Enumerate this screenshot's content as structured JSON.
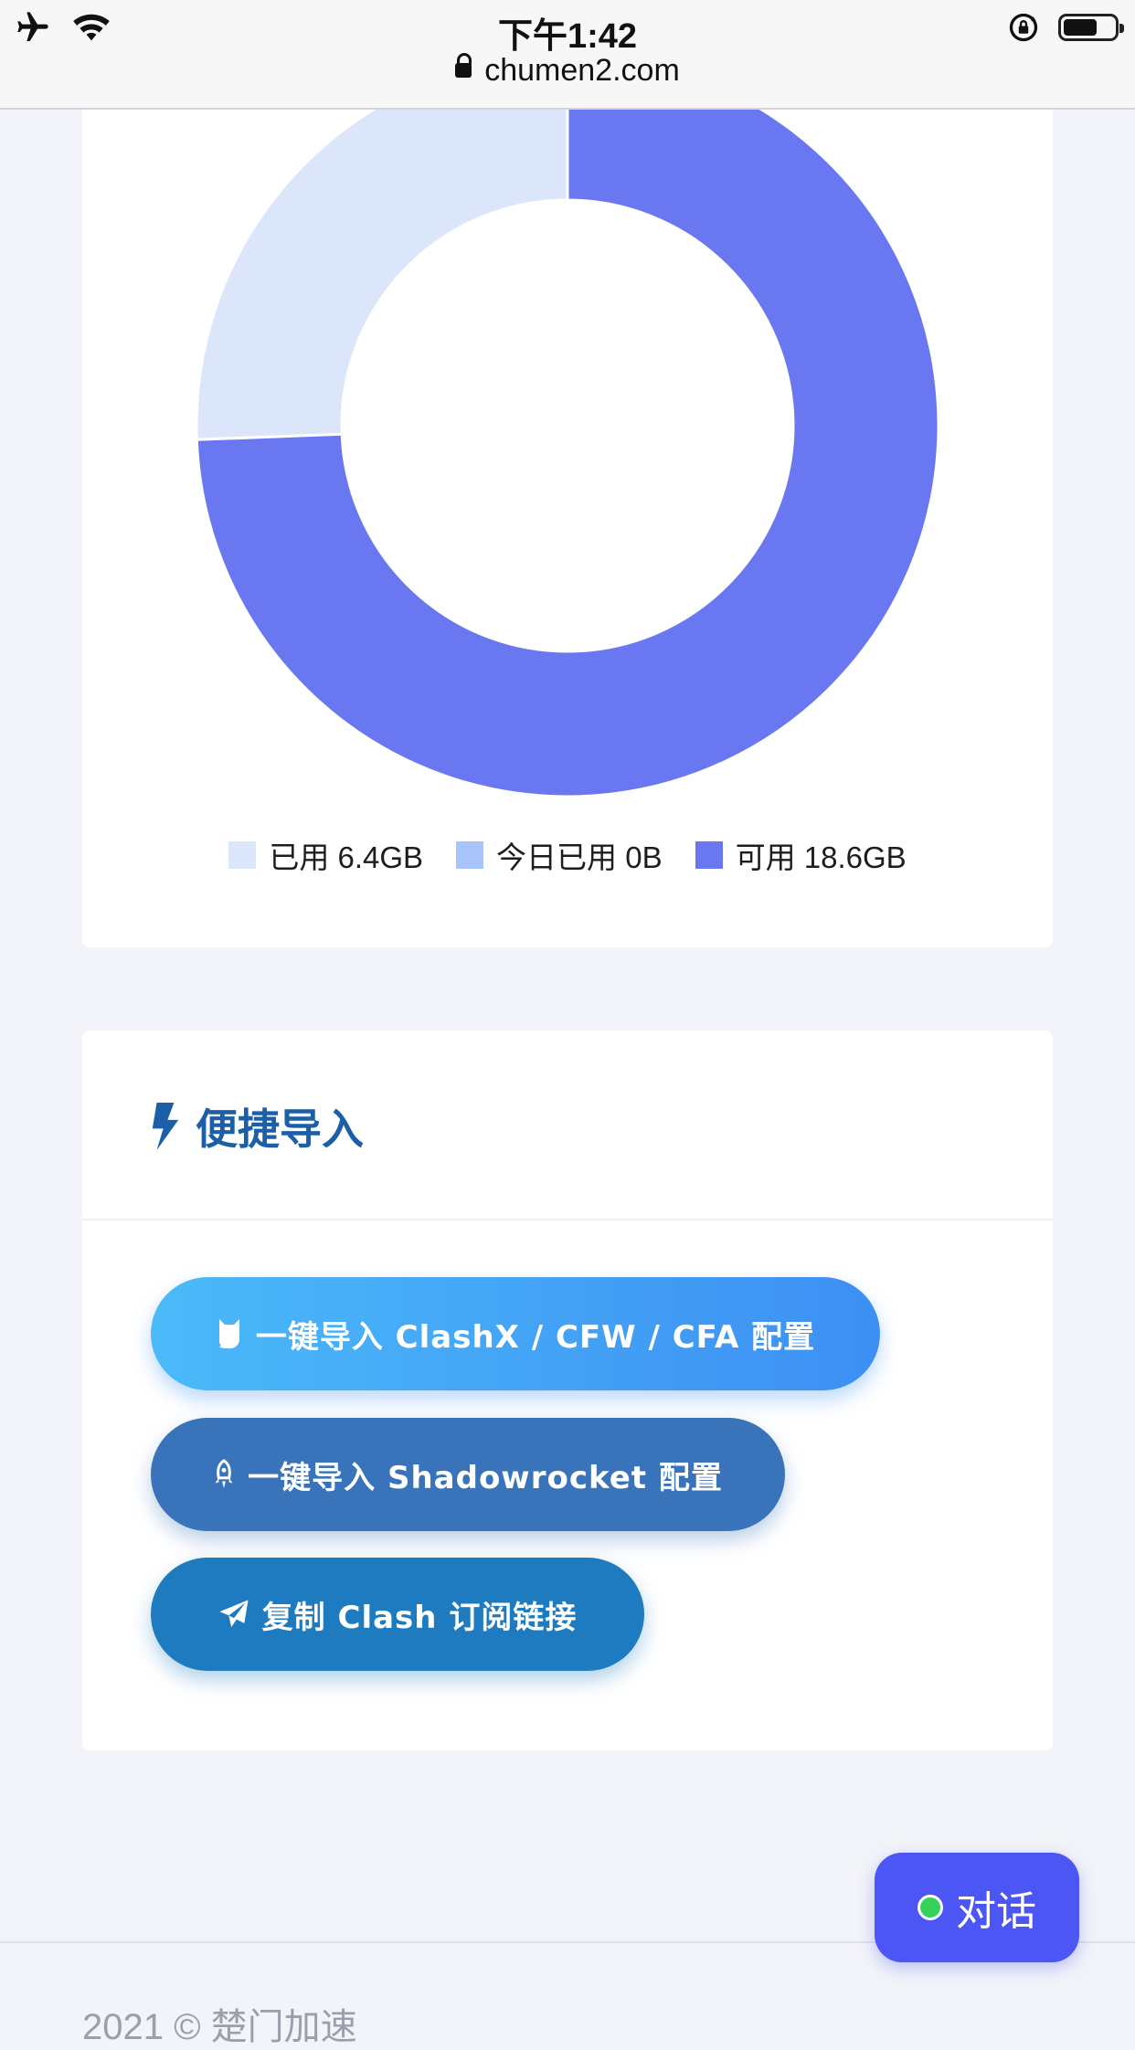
{
  "status_bar": {
    "time": "下午1:42"
  },
  "url_bar": {
    "domain": "chumen2.com"
  },
  "usage_chart": {
    "legend": [
      {
        "label": "已用 6.4GB",
        "color": "#dce6fb"
      },
      {
        "label": "今日已用 0B",
        "color": "#a9c4fb"
      },
      {
        "label": "可用 18.6GB",
        "color": "#6977f0"
      }
    ]
  },
  "chart_data": {
    "type": "pie",
    "categories": [
      "已用",
      "今日已用",
      "可用"
    ],
    "values": [
      6.4,
      0,
      18.6
    ],
    "units": "GB",
    "colors": [
      "#dce6fb",
      "#a9c4fb",
      "#6977f0"
    ]
  },
  "quick_import": {
    "title": "便捷导入",
    "buttons": {
      "clash": "一键导入 ClashX / CFW / CFA 配置",
      "shadowrocket": "一键导入 Shadowrocket 配置",
      "copy": "复制 Clash 订阅链接"
    }
  },
  "chat": {
    "label": "对话"
  },
  "footer": {
    "text": "2021 © 楚门加速"
  }
}
